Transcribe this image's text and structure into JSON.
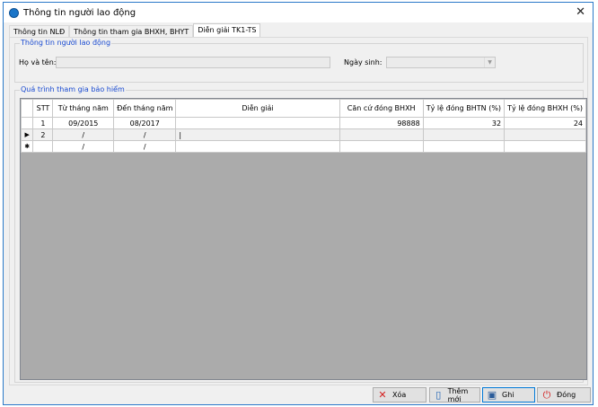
{
  "window": {
    "title": "Thông tin người lao động",
    "close": "✕"
  },
  "tabs": [
    {
      "label": "Thông tin NLĐ"
    },
    {
      "label": "Thông tin tham gia BHXH, BHYT"
    },
    {
      "label": "Diễn giải TK1-TS"
    }
  ],
  "worker_group": {
    "title": "Thông tin người lao động",
    "name_label": "Họ và tên:",
    "name_value": "",
    "dob_label": "Ngày sinh:",
    "dob_value": ""
  },
  "history_group": {
    "title": "Quá trình tham gia bảo hiểm",
    "columns": [
      "STT",
      "Từ tháng năm",
      "Đến tháng năm",
      "Diễn giải",
      "Căn cứ đóng BHXH",
      "Tỷ lệ đóng BHTN (%)",
      "Tỷ lệ đóng BHXH (%)"
    ],
    "rows": [
      {
        "marker": "",
        "stt": "1",
        "from": "09/2015",
        "to": "08/2017",
        "desc": "",
        "base": "98888",
        "bhtn": "32",
        "bhxh": "24"
      },
      {
        "marker": "▶",
        "stt": "2",
        "from": "/",
        "to": "/",
        "desc": "|",
        "base": "",
        "bhtn": "",
        "bhxh": ""
      },
      {
        "marker": "✱",
        "stt": "",
        "from": "/",
        "to": "/",
        "desc": "",
        "base": "",
        "bhtn": "",
        "bhxh": ""
      }
    ]
  },
  "buttons": {
    "delete": "Xóa",
    "add": "Thêm mới",
    "save": "Ghi",
    "close": "Đóng"
  }
}
